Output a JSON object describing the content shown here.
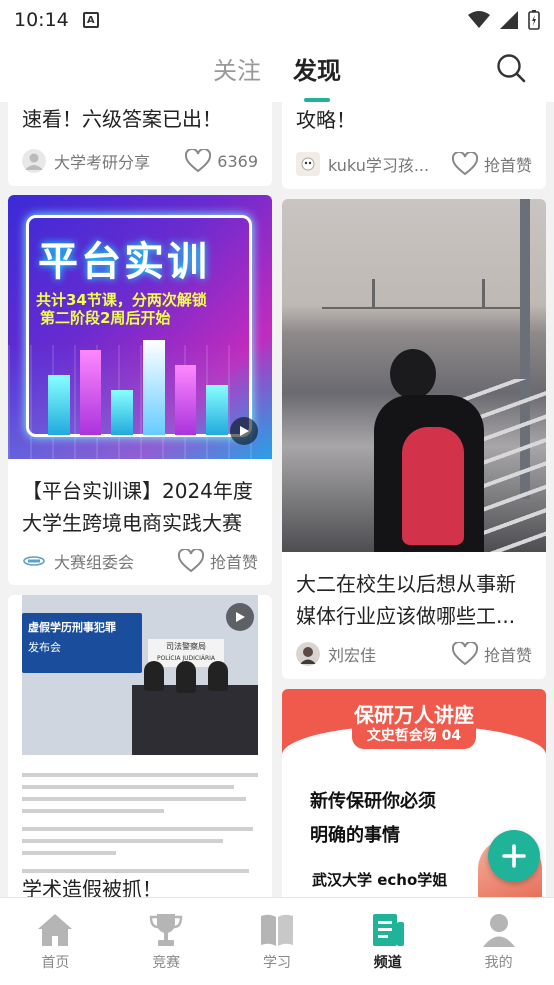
{
  "status": {
    "time": "10:14",
    "a_icon": "A"
  },
  "header": {
    "tabs": [
      {
        "label": "关注"
      },
      {
        "label": "发现"
      }
    ]
  },
  "feed": {
    "left": [
      {
        "title": "速看！六级答案已出！",
        "author": "大学考研分享",
        "likes": "6369"
      },
      {
        "title": "【平台实训课】2024年度大学生跨境电商实践大赛",
        "author": "大赛组委会",
        "likes": "抢首赞",
        "poster": {
          "headline": "平台实训",
          "line1": "共计34节课，分两次解锁",
          "line2": "第二阶段2周后开始"
        }
      },
      {
        "title": "学术造假被抓！",
        "image": {
          "banner": "虚假学历刑事犯罪",
          "sub": "发布会",
          "sign": "司法警察局",
          "sign_en": "POLÍCIA JUDICIÁRIA"
        }
      }
    ],
    "right": [
      {
        "title": "攻略！",
        "author": "kuku学习孩...",
        "likes": "抢首赞"
      },
      {
        "title": "大二在校生以后想从事新媒体行业应该做哪些工...",
        "author": "刘宏佳",
        "likes": "抢首赞"
      },
      {
        "poster": {
          "headline": "保研万人讲座",
          "sub": "文史哲会场 04",
          "line1": "新传保研你必须",
          "line2": "明确的事情",
          "footer": "武汉大学 echo学姐"
        }
      }
    ]
  },
  "bottom_nav": [
    {
      "label": "首页"
    },
    {
      "label": "竞赛"
    },
    {
      "label": "学习"
    },
    {
      "label": "频道"
    },
    {
      "label": "我的"
    }
  ],
  "colors": {
    "accent": "#1fb39a",
    "inactive": "#999999"
  }
}
